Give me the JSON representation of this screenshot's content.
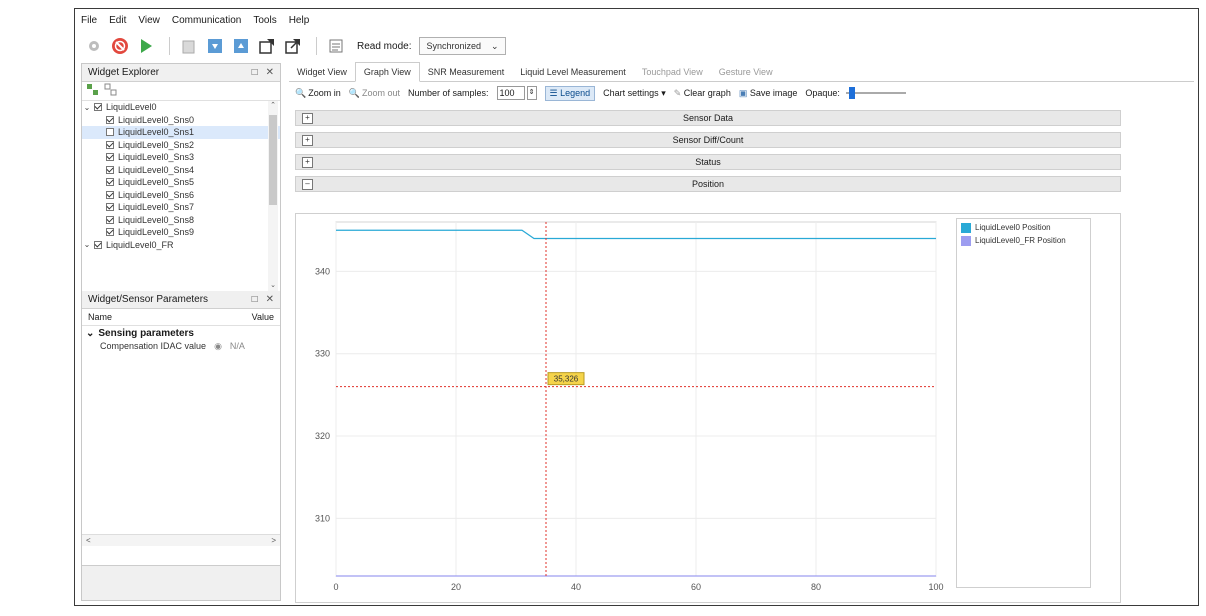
{
  "menu": [
    "File",
    "Edit",
    "View",
    "Communication",
    "Tools",
    "Help"
  ],
  "toolbar": {
    "read_mode_label": "Read mode:",
    "read_mode_value": "Synchronized"
  },
  "widget_explorer": {
    "title": "Widget Explorer",
    "tree": [
      {
        "label": "LiquidLevel0",
        "level": 0,
        "checked": true,
        "expanded": true
      },
      {
        "label": "LiquidLevel0_Sns0",
        "level": 1,
        "checked": true
      },
      {
        "label": "LiquidLevel0_Sns1",
        "level": 1,
        "checked": false,
        "selected": true
      },
      {
        "label": "LiquidLevel0_Sns2",
        "level": 1,
        "checked": true
      },
      {
        "label": "LiquidLevel0_Sns3",
        "level": 1,
        "checked": true
      },
      {
        "label": "LiquidLevel0_Sns4",
        "level": 1,
        "checked": true
      },
      {
        "label": "LiquidLevel0_Sns5",
        "level": 1,
        "checked": true
      },
      {
        "label": "LiquidLevel0_Sns6",
        "level": 1,
        "checked": true
      },
      {
        "label": "LiquidLevel0_Sns7",
        "level": 1,
        "checked": true
      },
      {
        "label": "LiquidLevel0_Sns8",
        "level": 1,
        "checked": true
      },
      {
        "label": "LiquidLevel0_Sns9",
        "level": 1,
        "checked": true
      },
      {
        "label": "LiquidLevel0_FR",
        "level": 0,
        "checked": true,
        "expanded": true
      }
    ]
  },
  "params": {
    "title": "Widget/Sensor Parameters",
    "col_name": "Name",
    "col_value": "Value",
    "group": "Sensing parameters",
    "row_name": "Compensation IDAC value",
    "row_value": "N/A"
  },
  "tabs": [
    {
      "label": "Widget View",
      "active": false,
      "enabled": true
    },
    {
      "label": "Graph View",
      "active": true,
      "enabled": true
    },
    {
      "label": "SNR Measurement",
      "active": false,
      "enabled": true
    },
    {
      "label": "Liquid Level Measurement",
      "active": false,
      "enabled": true
    },
    {
      "label": "Touchpad View",
      "active": false,
      "enabled": false
    },
    {
      "label": "Gesture View",
      "active": false,
      "enabled": false
    }
  ],
  "graph_toolbar": {
    "zoom_in": "Zoom in",
    "zoom_out": "Zoom out",
    "samples_label": "Number of samples:",
    "samples_value": "100",
    "legend": "Legend",
    "chart_settings": "Chart settings",
    "clear_graph": "Clear graph",
    "save_image": "Save image",
    "opaque": "Opaque:",
    "opaque_level": 0.05
  },
  "sections": [
    {
      "label": "Sensor Data",
      "expanded": false
    },
    {
      "label": "Sensor Diff/Count",
      "expanded": false
    },
    {
      "label": "Status",
      "expanded": false
    },
    {
      "label": "Position",
      "expanded": true
    }
  ],
  "colors": {
    "series1": "#29a9d6",
    "series2": "#9d9df0",
    "crosshair": "#e0302a"
  },
  "cursor_label": "35,326",
  "chart_data": {
    "type": "line",
    "xlim": [
      0,
      100
    ],
    "ylim": [
      303,
      346
    ],
    "x_ticks": [
      0,
      20,
      40,
      60,
      80,
      100
    ],
    "y_ticks": [
      310,
      320,
      330,
      340
    ],
    "grid": true,
    "legend_placement": "right",
    "series": [
      {
        "name": "LiquidLevel0 Position",
        "x": [
          0,
          31,
          33,
          100
        ],
        "values": [
          345,
          345,
          344,
          344
        ]
      },
      {
        "name": "LiquidLevel0_FR Position",
        "x": [
          0,
          100
        ],
        "values": [
          303,
          303
        ]
      }
    ],
    "crosshair": {
      "x": 35,
      "y": 326
    }
  }
}
